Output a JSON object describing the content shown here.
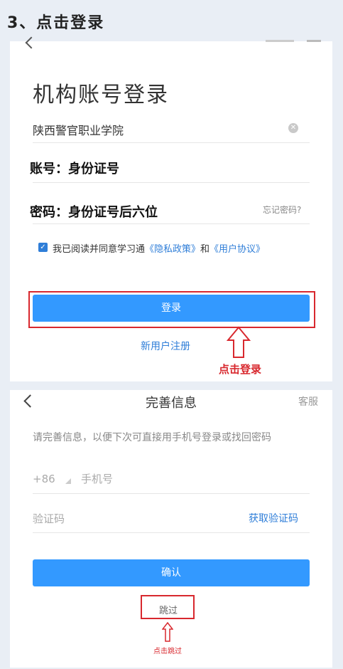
{
  "step_title": "3、点击登录",
  "login_screen": {
    "title": "机构账号登录",
    "school": "陕西警官职业学院",
    "clear_icon": "✕",
    "account_label": "账号：身份证号",
    "password_label": "密码：身份证号后六位",
    "forgot_password": "忘记密码?",
    "agreement": {
      "prefix": "我已阅读并同意学习通",
      "privacy": "《隐私政策》",
      "and": "和",
      "user_agreement": "《用户协议》",
      "checked": true
    },
    "login_button": "登录",
    "register_link": "新用户注册",
    "annotation": "点击登录"
  },
  "complete_info_screen": {
    "title": "完善信息",
    "customer_service": "客服",
    "hint": "请完善信息，以便下次可直接用手机号登录或找回密码",
    "country_code": "+86",
    "phone_placeholder": "手机号",
    "code_placeholder": "验证码",
    "get_code": "获取验证码",
    "confirm_button": "确认",
    "skip": "跳过",
    "annotation": "点击跳过"
  },
  "colors": {
    "accent_blue": "#3399ff",
    "link_blue": "#2f7ed8",
    "annotation_red": "#d8282e"
  }
}
